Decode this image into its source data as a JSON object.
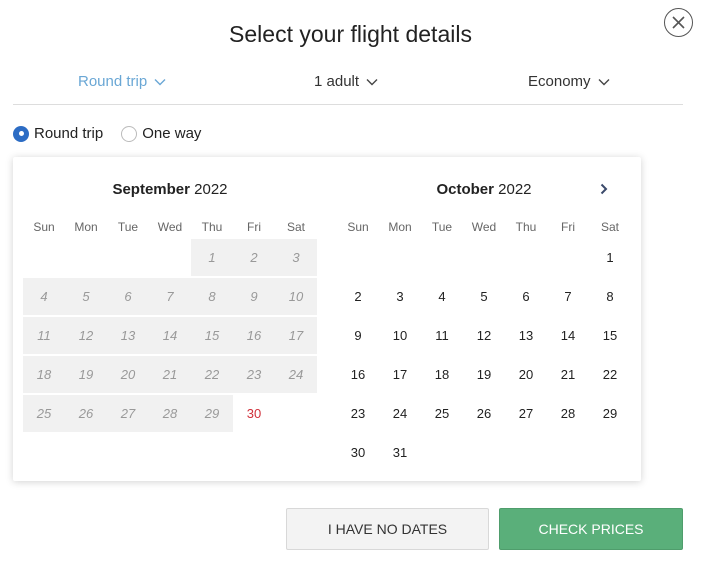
{
  "title": "Select your flight details",
  "options": {
    "trip_type": "Round trip",
    "passengers": "1 adult",
    "cabin_class": "Economy"
  },
  "radios": [
    {
      "label": "Round trip",
      "checked": true
    },
    {
      "label": "One way",
      "checked": false
    }
  ],
  "calendar": {
    "weekdays": [
      "Sun",
      "Mon",
      "Tue",
      "Wed",
      "Thu",
      "Fri",
      "Sat"
    ],
    "months": [
      {
        "name": "September",
        "year": "2022",
        "first_weekday": 4,
        "days": 30,
        "past_through": 29,
        "today": 30
      },
      {
        "name": "October",
        "year": "2022",
        "first_weekday": 6,
        "days": 31,
        "past_through": 0,
        "today": null
      }
    ]
  },
  "buttons": {
    "no_dates": "I HAVE NO DATES",
    "check_prices": "CHECK PRICES"
  },
  "colors": {
    "accent_blue": "#6aa7d5",
    "radio_blue": "#2c6cc4",
    "primary_green": "#5aaf7a",
    "today_red": "#d0303a"
  },
  "icons": {
    "close": "close-icon",
    "chevron_down": "chevron-down-icon",
    "chevron_right": "chevron-right-icon"
  }
}
